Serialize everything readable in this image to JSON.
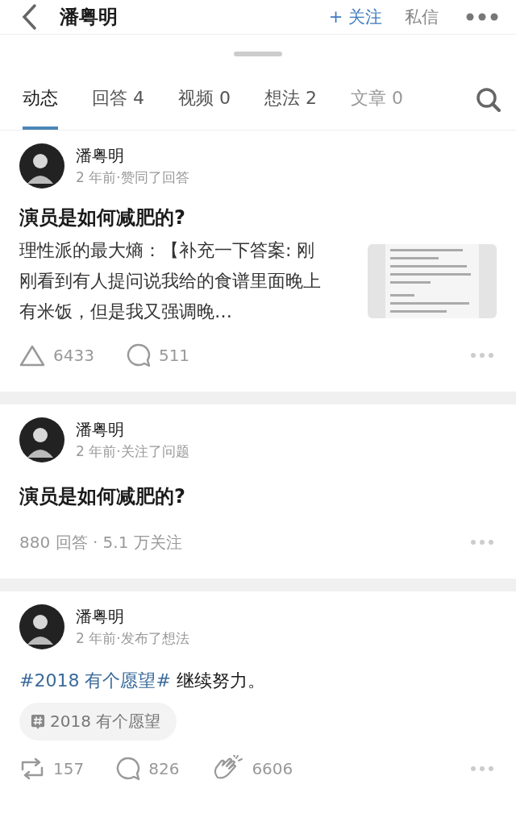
{
  "header": {
    "title": "潘粤明",
    "follow": "+ 关注",
    "message": "私信"
  },
  "tabs": [
    {
      "label": "动态",
      "selected": true,
      "faded": false
    },
    {
      "label": "回答 4",
      "selected": false,
      "faded": false
    },
    {
      "label": "视频 0",
      "selected": false,
      "faded": false
    },
    {
      "label": "想法 2",
      "selected": false,
      "faded": false
    },
    {
      "label": "文章 0",
      "selected": false,
      "faded": true
    }
  ],
  "feed": [
    {
      "kind": "answer",
      "author": "潘粤明",
      "meta": "2 年前·赞同了回答",
      "title": "演员是如何减肥的?",
      "excerpt": "理性派的最大熵：【补充一下答案: 刚刚看到有人提问说我给的食谱里面晚上有米饭，但是我又强调晚…",
      "thumbnail": {
        "kind": "picture"
      },
      "actions": [
        {
          "kind": "vote",
          "count": "6433"
        },
        {
          "kind": "comment",
          "count": "511"
        }
      ]
    },
    {
      "kind": "question",
      "author": "潘粤明",
      "meta": "2 年前·关注了问题",
      "title": "演员是如何减肥的?",
      "stats": "880 回答 · 5.1 万关注"
    },
    {
      "kind": "thought",
      "author": "潘粤明",
      "meta": "2 年前·发布了想法",
      "segments": [
        {
          "kind": "hashtag",
          "text": "#2018 有个愿望#"
        },
        {
          "kind": "plain",
          "text": " 继续努力。"
        }
      ],
      "topic": "2018 有个愿望",
      "actions": [
        {
          "kind": "repost",
          "count": "157"
        },
        {
          "kind": "comment",
          "count": "826"
        },
        {
          "kind": "clap",
          "count": "6606"
        }
      ]
    }
  ]
}
